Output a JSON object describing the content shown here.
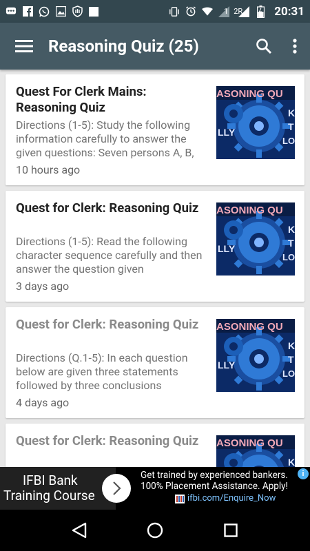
{
  "status_bar": {
    "time": "20:31",
    "signal1_label": "1",
    "signal2_label": "2R",
    "icons_left": [
      "chat-icon",
      "facebook-icon",
      "whatsapp-icon",
      "image-icon",
      "shield-icon",
      "square-icon"
    ],
    "icons_right": [
      "vibrate-icon",
      "alarm-icon",
      "wifi-icon",
      "signal-icon",
      "signal-icon",
      "battery-icon"
    ]
  },
  "toolbar": {
    "title": "Reasoning Quiz (25)"
  },
  "cards": [
    {
      "title": "Quest For Clerk Mains: Reasoning Quiz",
      "description": "Directions (1-5): Study the following information carefully to answer the given questions: Seven persons A, B,",
      "time": "10 hours ago",
      "read": false
    },
    {
      "title": "Quest for Clerk: Reasoning Quiz",
      "description": "Directions (1-5): Read the following character sequence carefully and then answer the question given",
      "time": "3 days ago",
      "read": false
    },
    {
      "title": "Quest for Clerk: Reasoning Quiz",
      "description": "Directions (Q.1-5): In each question below are given three statements followed by three conclusions",
      "time": "4 days ago",
      "read": true
    },
    {
      "title": "Quest for Clerk: Reasoning Quiz",
      "description": "",
      "time": "",
      "read": true
    }
  ],
  "thumbnail": {
    "banner_text": "ASONING QU",
    "side_letters": [
      "K",
      "T"
    ],
    "bottom_left": "LLY",
    "bottom_right": "LO"
  },
  "ad": {
    "left_line1": "IFBI Bank",
    "left_line2": "Training Course",
    "right_text": "Get trained by experienced bankers. 100% Placement Assistance. Apply!",
    "link": "ifbi.com/Enquire_Now",
    "info": "i"
  }
}
